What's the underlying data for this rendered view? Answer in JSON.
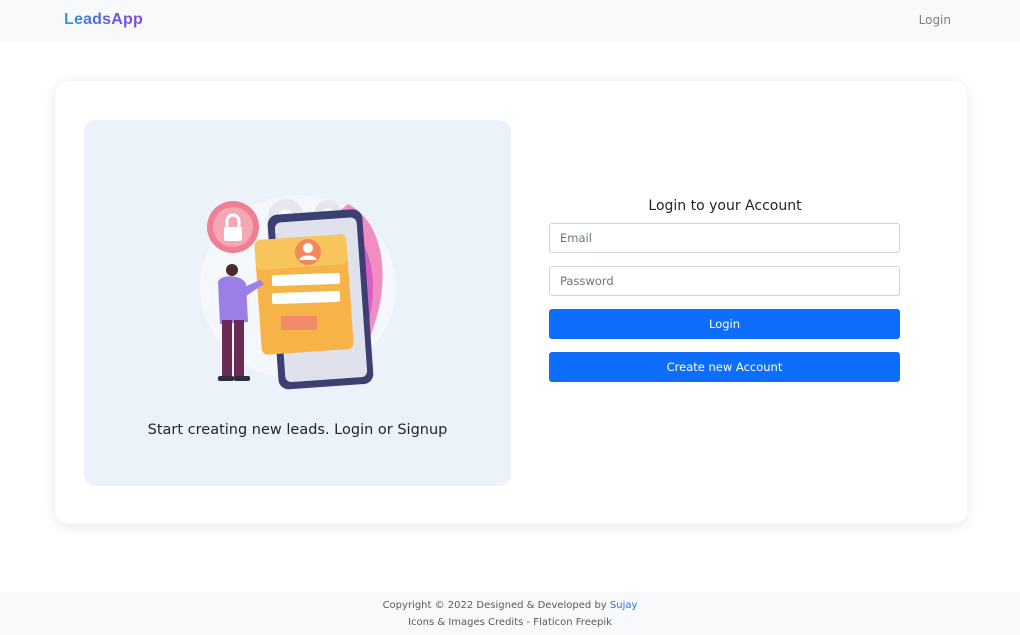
{
  "navbar": {
    "brand": "LeadsApp",
    "login_link": "Login"
  },
  "hero": {
    "tagline": "Start creating new leads. Login or Signup"
  },
  "form": {
    "title": "Login to your Account",
    "email_placeholder": "Email",
    "password_placeholder": "Password",
    "login_button": "Login",
    "create_button": "Create new Account"
  },
  "footer": {
    "copyright_prefix": "Copyright © 2022 Designed & Developed by",
    "author": "Sujay",
    "credits": "Icons & Images Credits - Flaticon Freepik"
  },
  "colors": {
    "primary": "#0d6efd",
    "panel": "#ecf2fa",
    "brand_gradient_start": "#2b9fd8",
    "brand_gradient_end": "#8a45d6"
  }
}
